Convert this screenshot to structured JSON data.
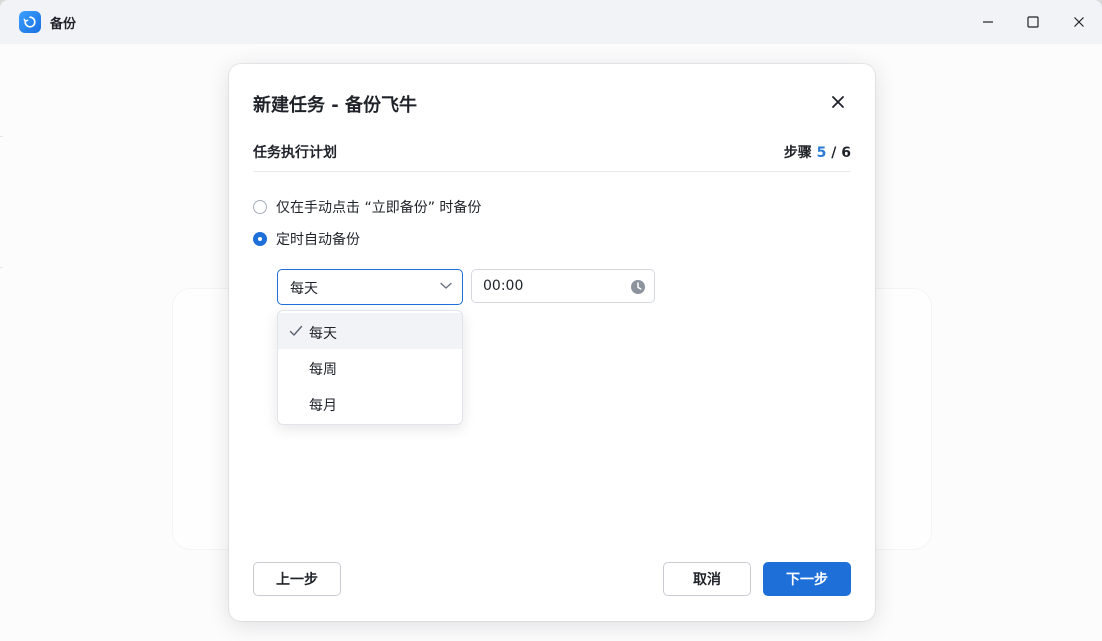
{
  "window": {
    "title": "备份"
  },
  "dialog": {
    "title": "新建任务 - 备份飞牛",
    "section_title": "任务执行计划",
    "step": {
      "prefix": "步骤",
      "current": "5",
      "separator": "/",
      "total": "6"
    },
    "options": [
      {
        "label": "仅在手动点击 “立即备份” 时备份",
        "checked": false
      },
      {
        "label": "定时自动备份",
        "checked": true
      }
    ],
    "frequency": {
      "selected": "每天",
      "options": [
        {
          "label": "每天",
          "selected": true
        },
        {
          "label": "每周",
          "selected": false
        },
        {
          "label": "每月",
          "selected": false
        }
      ]
    },
    "time": {
      "value": "00:00"
    },
    "buttons": {
      "prev": "上一步",
      "cancel": "取消",
      "next": "下一步"
    }
  },
  "colors": {
    "accent": "#1f6fd9",
    "step_current": "#2a7ad6"
  },
  "icons": {
    "app": "sync-icon",
    "minimize": "minimize-icon",
    "maximize": "maximize-icon",
    "close": "close-icon",
    "chevron": "chevron-down-icon",
    "clock": "clock-icon",
    "check": "check-icon"
  }
}
